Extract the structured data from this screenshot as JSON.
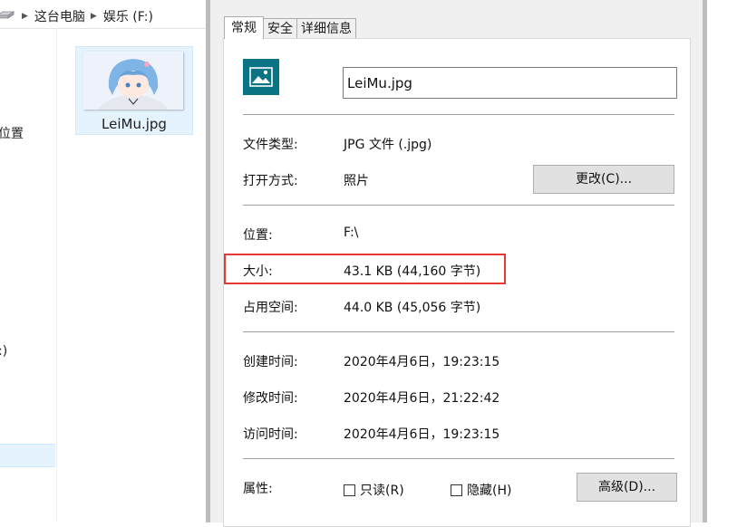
{
  "explorer": {
    "breadcrumb": [
      "这台电脑",
      "娱乐 (F:)"
    ],
    "nav_fragments": [
      "位置",
      ":)"
    ],
    "file_tile": {
      "name": "LeiMu.jpg"
    }
  },
  "dialog": {
    "tabs": [
      {
        "label": "常规",
        "active": true
      },
      {
        "label": "安全",
        "active": false
      },
      {
        "label": "详细信息",
        "active": false
      }
    ],
    "file_name": "LeiMu.jpg",
    "file_type_label": "文件类型:",
    "file_type_value": "JPG 文件 (.jpg)",
    "opens_with_label": "打开方式:",
    "opens_with_value": "照片",
    "change_button": "更改(C)...",
    "location_label": "位置:",
    "location_value": "F:\\",
    "size_label": "大小:",
    "size_value": "43.1 KB (44,160 字节)",
    "size_on_disk_label": "占用空间:",
    "size_on_disk_value": "44.0 KB (45,056 字节)",
    "created_label": "创建时间:",
    "created_value": "2020年4月6日，19:23:15",
    "modified_label": "修改时间:",
    "modified_value": "2020年4月6日，21:22:42",
    "accessed_label": "访问时间:",
    "accessed_value": "2020年4月6日，19:23:15",
    "attributes_label": "属性:",
    "readonly_label": "只读(R)",
    "hidden_label": "隐藏(H)",
    "advanced_button": "高级(D)..."
  },
  "colors": {
    "highlight_box": "#e53935",
    "file_icon": "#0a7384",
    "selection": "#e5f3ff"
  },
  "icons": [
    "drive-icon",
    "chevron-right-icon",
    "image-file-icon",
    "image-thumbnail"
  ]
}
